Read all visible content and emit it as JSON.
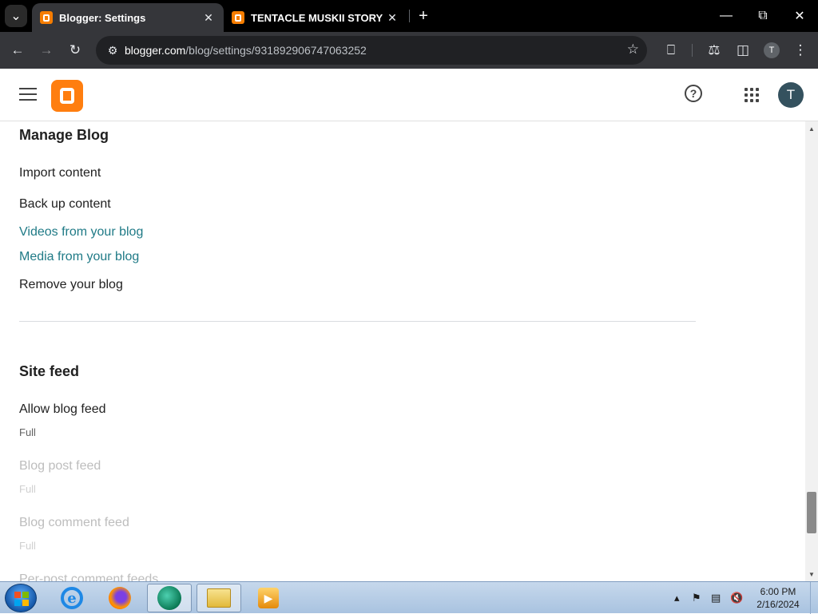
{
  "browser": {
    "tabs": [
      {
        "title": "Blogger: Settings",
        "active": true
      },
      {
        "title": "TENTACLE MUSKII STORY",
        "active": false
      }
    ],
    "url_host": "blogger.com",
    "url_path": "/blog/settings/931892906747063252",
    "profile_initial": "T"
  },
  "header": {
    "avatar_initial": "T"
  },
  "manage_blog": {
    "title": "Manage Blog",
    "items": [
      {
        "label": "Import content",
        "style": "normal"
      },
      {
        "label": "Back up content",
        "style": "normal"
      },
      {
        "label": "Videos from your blog",
        "style": "link"
      },
      {
        "label": "Media from your blog",
        "style": "link"
      },
      {
        "label": "Remove your blog",
        "style": "normal"
      }
    ]
  },
  "site_feed": {
    "title": "Site feed",
    "items": [
      {
        "label": "Allow blog feed",
        "value": "Full",
        "enabled": true
      },
      {
        "label": "Blog post feed",
        "value": "Full",
        "enabled": false
      },
      {
        "label": "Blog comment feed",
        "value": "Full",
        "enabled": false
      },
      {
        "label": "Per-post comment feeds",
        "enabled": false
      }
    ]
  },
  "taskbar": {
    "time": "6:00 PM",
    "date": "2/16/2024"
  },
  "colors": {
    "link": "#1f7a86",
    "blogger_orange": "#ff7e0f",
    "tabstrip": "#000000",
    "toolbar": "#35363a"
  }
}
